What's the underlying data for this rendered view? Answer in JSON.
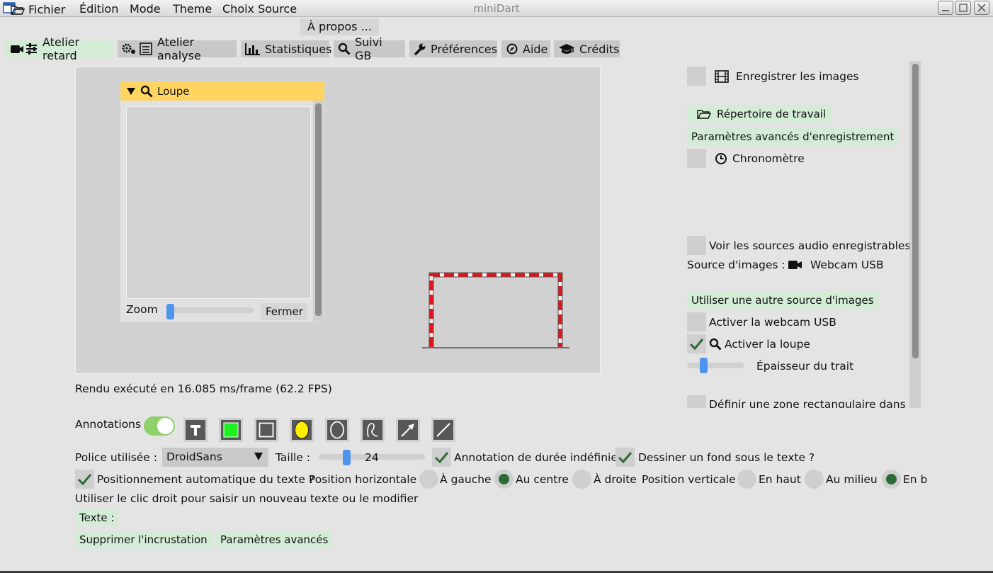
{
  "window": {
    "title": "miniDart"
  },
  "menu": [
    "Fichier",
    "Édition",
    "Mode",
    "Theme",
    "Choix Source",
    "À propos ..."
  ],
  "tabs": [
    {
      "label": "Atelier retard",
      "icon": "video-camera-sliders-icon",
      "selected": true
    },
    {
      "label": "Atelier analyse",
      "icon": "gears-list-icon"
    },
    {
      "label": "Statistiques",
      "icon": "bar-chart-icon"
    },
    {
      "label": "Suivi GB",
      "icon": "search-icon"
    },
    {
      "label": "Préférences",
      "icon": "wrench-icon"
    },
    {
      "label": "Aide",
      "icon": "compass-icon"
    },
    {
      "label": "Crédits",
      "icon": "graduation-cap-icon"
    }
  ],
  "loupe": {
    "title": "Loupe",
    "zoom_label": "Zoom",
    "close_label": "Fermer",
    "zoom_level": 0.02
  },
  "render_status": "Rendu exécuté en 16.085 ms/frame (62.2 FPS)",
  "right_panel": {
    "save_images": "Enregistrer les images",
    "work_dir": "Répertoire de travail",
    "advanced_rec": "Paramètres avancés d'enregistrement",
    "chrono": "Chronomètre",
    "audio_sources": "Voir les sources audio enregistrables",
    "image_source_label": "Source d'images :",
    "image_source_value": "Webcam USB",
    "other_source": "Utiliser une autre source d'images",
    "activate_webcam": "Activer la webcam USB",
    "activate_loupe": "Activer la loupe",
    "line_thickness": "Épaisseur du trait",
    "define_zone": "Définir une zone rectangulaire dans l'i"
  },
  "annotations": {
    "label": "Annotations",
    "enabled": true,
    "tools": [
      "text-tool-icon",
      "green-filled-rect-icon",
      "rect-outline-icon",
      "yellow-ellipse-icon",
      "ellipse-outline-icon",
      "freehand-icon",
      "arrow-icon",
      "line-icon"
    ],
    "font_label": "Police utilisée :",
    "font_value": "DroidSans",
    "size_label": "Taille :",
    "size_value": "24",
    "size_slider_level": 0.25,
    "indefinite_duration": "Annotation de durée indéfinie",
    "draw_background": "Dessiner un fond sous le texte ?",
    "auto_position": "Positionnement automatique du texte ?",
    "horizontal_label": "Position horizontale",
    "left": "À gauche",
    "center": "Au centre",
    "right": "À droite",
    "vertical_label": "Position verticale",
    "top": "En haut",
    "middle": "Au milieu",
    "bottom": "En b",
    "hint": "Utiliser le clic droit pour saisir un nouveau texte ou le modifier",
    "text_label": "Texte :",
    "remove_overlay": "Supprimer l'incrustation",
    "advanced_params": "Paramètres avancés"
  },
  "colors": {
    "accent_green": "#d3ecd6",
    "loupe_header": "#ffd461",
    "check_green": "#2d6b36",
    "slider_blue": "#4d94ee",
    "goal_red": "#e0161b"
  }
}
